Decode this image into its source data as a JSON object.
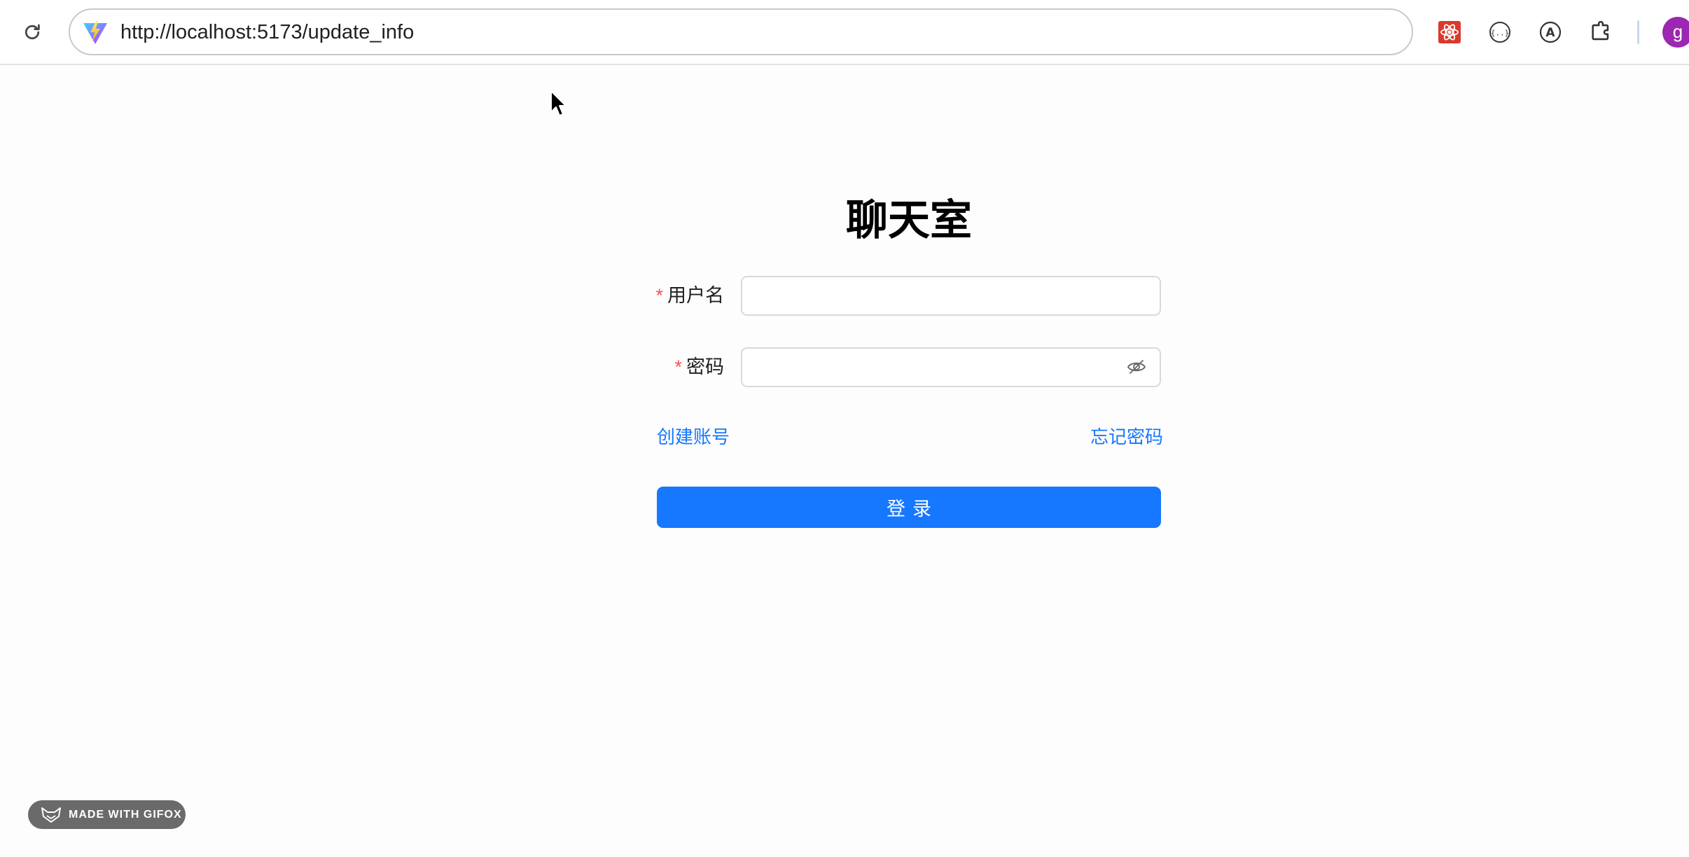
{
  "browser": {
    "url": "http://localhost:5173/update_info",
    "icons": {
      "reload": "reload-icon",
      "site": "vite-logo-icon",
      "ext1": "react-devtools-extension-icon",
      "ext2": "json-formatter-extension-icon",
      "ext3": "translate-a-extension-icon",
      "ext4": "puzzle-extensions-icon"
    },
    "profile_initial": "g"
  },
  "login": {
    "title": "聊天室",
    "username": {
      "label": "用户名",
      "required_mark": "*",
      "value": ""
    },
    "password": {
      "label": "密码",
      "required_mark": "*",
      "value": ""
    },
    "create_account_link": "创建账号",
    "forgot_password_link": "忘记密码",
    "submit_label": "登录"
  },
  "watermark": {
    "text": "MADE WITH GIFOX"
  },
  "colors": {
    "primary": "#1677ff",
    "required": "#ff4d4f",
    "input_border": "#d9d9d9",
    "avatar": "#9c27b0"
  }
}
